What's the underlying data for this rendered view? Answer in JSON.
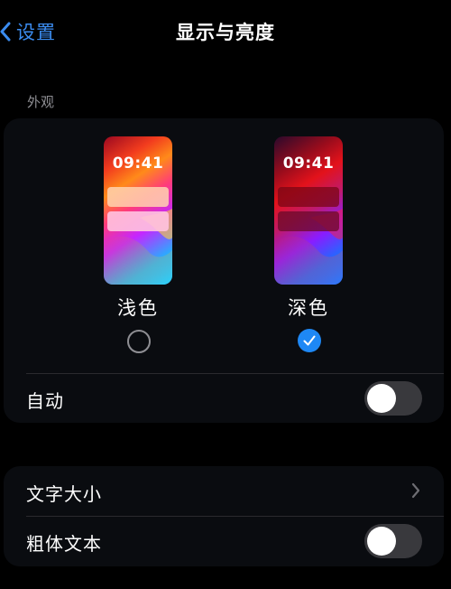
{
  "nav": {
    "back_label": "设置",
    "title": "显示与亮度"
  },
  "appearance": {
    "header": "外观",
    "options": [
      {
        "label": "浅色",
        "time": "09:41",
        "selected": false
      },
      {
        "label": "深色",
        "time": "09:41",
        "selected": true
      }
    ]
  },
  "rows": {
    "auto": {
      "label": "自动",
      "on": false
    },
    "text_size": {
      "label": "文字大小"
    },
    "bold_text": {
      "label": "粗体文本",
      "on": false
    }
  },
  "colors": {
    "accent": "#1e88f5",
    "link": "#3b8cf0",
    "toggle_off": "#39393d",
    "group_bg": "#0a0c10"
  }
}
